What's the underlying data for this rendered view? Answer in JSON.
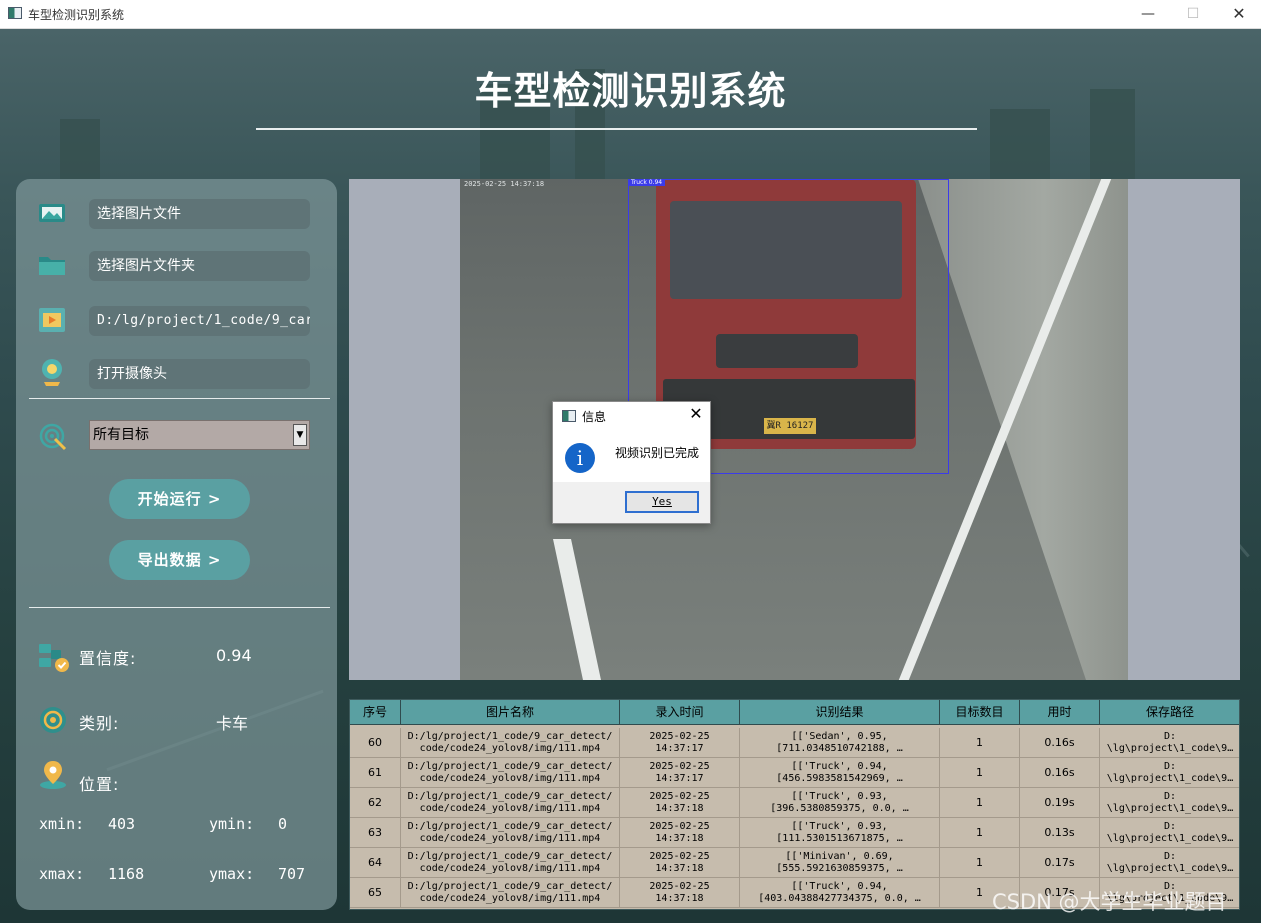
{
  "window": {
    "title": "车型检测识别系统",
    "minimize_glyph": "—",
    "maximize_glyph": "☐",
    "close_glyph": "✕"
  },
  "header": {
    "title": "车型检测识别系统"
  },
  "left_panel": {
    "select_image_label": "选择图片文件",
    "select_folder_label": "选择图片文件夹",
    "video_path_value": "D:/lg/project/1_code/9_car_",
    "open_camera_label": "打开摄像头",
    "target_select_value": "所有目标",
    "start_button_label": "开始运行 >",
    "export_button_label": "导出数据 >",
    "confidence_label": "置信度:",
    "confidence_value": "0.94",
    "class_label": "类别:",
    "class_value": "卡车",
    "position_label": "位置:",
    "xmin_label": "xmin:",
    "xmin_value": "403",
    "ymin_label": "ymin:",
    "ymin_value": "0",
    "xmax_label": "xmax:",
    "xmax_value": "1168",
    "ymax_label": "ymax:",
    "ymax_value": "707",
    "icons": {
      "image_file": "image-file-icon",
      "folder": "folder-icon",
      "video": "video-icon",
      "camera": "webcam-icon",
      "target": "target-icon",
      "confidence": "confidence-icon",
      "class": "class-icon",
      "position": "location-pin-icon"
    }
  },
  "display": {
    "bbox_label": "Truck 0.94",
    "plate_text": "冀R 16127",
    "timestamp_text": "2025-02-25 14:37:18"
  },
  "dialog": {
    "title": "信息",
    "message": "视频识别已完成",
    "ok_button": "Yes",
    "info_glyph": "i",
    "close_glyph": "✕"
  },
  "table": {
    "columns": [
      "序号",
      "图片名称",
      "录入时间",
      "识别结果",
      "目标数目",
      "用时",
      "保存路径"
    ],
    "rows": [
      [
        "60",
        "D:/lg/project/1_code/9_car_detect/\ncode/code24_yolov8/img/111.mp4",
        "2025-02-25\n14:37:17",
        "[['Sedan', 0.95,\n[711.0348510742188, …",
        "1",
        "0.16s",
        "D:\n\\lg\\project\\1_code\\9…"
      ],
      [
        "61",
        "D:/lg/project/1_code/9_car_detect/\ncode/code24_yolov8/img/111.mp4",
        "2025-02-25\n14:37:17",
        "[['Truck', 0.94,\n[456.5983581542969, …",
        "1",
        "0.16s",
        "D:\n\\lg\\project\\1_code\\9…"
      ],
      [
        "62",
        "D:/lg/project/1_code/9_car_detect/\ncode/code24_yolov8/img/111.mp4",
        "2025-02-25\n14:37:18",
        "[['Truck', 0.93,\n[396.5380859375, 0.0, …",
        "1",
        "0.19s",
        "D:\n\\lg\\project\\1_code\\9…"
      ],
      [
        "63",
        "D:/lg/project/1_code/9_car_detect/\ncode/code24_yolov8/img/111.mp4",
        "2025-02-25\n14:37:18",
        "[['Truck', 0.93,\n[111.5301513671875, …",
        "1",
        "0.13s",
        "D:\n\\lg\\project\\1_code\\9…"
      ],
      [
        "64",
        "D:/lg/project/1_code/9_car_detect/\ncode/code24_yolov8/img/111.mp4",
        "2025-02-25\n14:37:18",
        "[['Minivan', 0.69,\n[555.5921630859375, …",
        "1",
        "0.17s",
        "D:\n\\lg\\project\\1_code\\9…"
      ],
      [
        "65",
        "D:/lg/project/1_code/9_car_detect/\ncode/code24_yolov8/img/111.mp4",
        "2025-02-25\n14:37:18",
        "[['Truck', 0.94,\n[403.04388427734375, 0.0, …",
        "1",
        "0.17s",
        "D:\n\\lg\\project\\1_code\\9…"
      ]
    ]
  },
  "watermark": "CSDN @大学生毕业题目"
}
